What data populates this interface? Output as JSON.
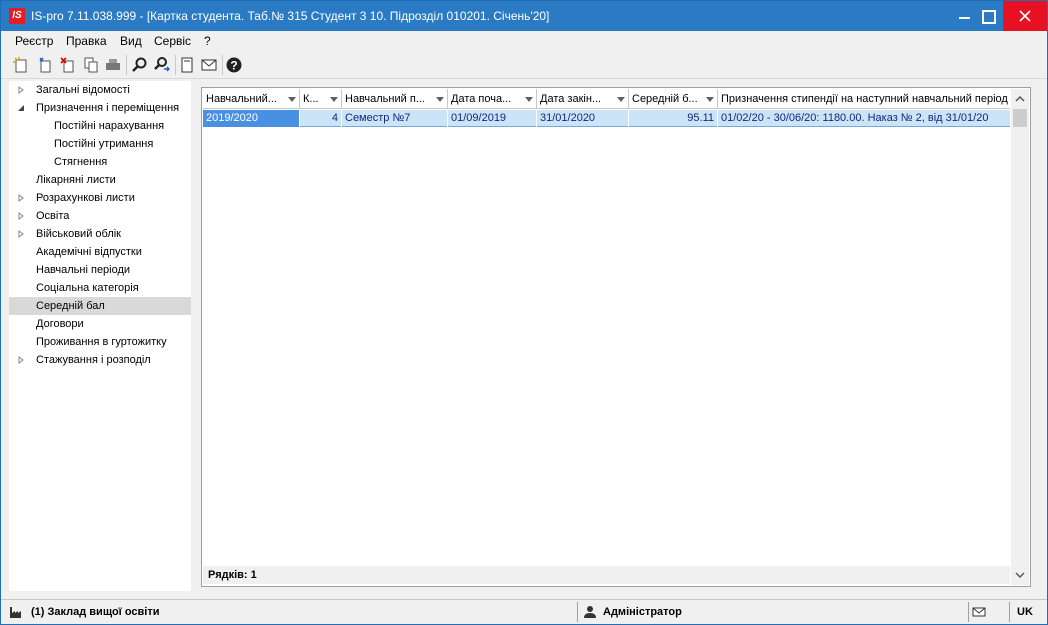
{
  "window": {
    "logo_text": "IS",
    "title": "IS-pro 7.11.038.999 - [Картка студента. Таб.№ 315 Студент 3 10. Підрозділ 010201. Січень'20]"
  },
  "menu": [
    "Реєстр",
    "Правка",
    "Вид",
    "Сервіс",
    "?"
  ],
  "toolbar": {
    "icons": [
      "new-icon",
      "copy-new-icon",
      "delete-icon",
      "duplicate-icon",
      "print-icon",
      "find-icon",
      "find-next-icon",
      "form-icon",
      "mail-icon",
      "help-icon"
    ]
  },
  "tree": {
    "items": [
      {
        "label": "Загальні відомості",
        "expand": "collapsed",
        "level": 0
      },
      {
        "label": "Призначення і переміщення",
        "expand": "expanded",
        "level": 0
      },
      {
        "label": "Постійні нарахування",
        "expand": "none",
        "level": 1
      },
      {
        "label": "Постійні утримання",
        "expand": "none",
        "level": 1
      },
      {
        "label": "Стягнення",
        "expand": "none",
        "level": 1
      },
      {
        "label": "Лікарняні листи",
        "expand": "none",
        "level": 0
      },
      {
        "label": "Розрахункові листи",
        "expand": "collapsed",
        "level": 0
      },
      {
        "label": "Освіта",
        "expand": "collapsed",
        "level": 0
      },
      {
        "label": "Військовий облік",
        "expand": "collapsed",
        "level": 0
      },
      {
        "label": "Академічні відпустки",
        "expand": "none",
        "level": 0
      },
      {
        "label": "Навчальні періоди",
        "expand": "none",
        "level": 0
      },
      {
        "label": "Соціальна категорія",
        "expand": "none",
        "level": 0
      },
      {
        "label": "Середній бал",
        "expand": "none",
        "level": 0,
        "selected": true
      },
      {
        "label": "Договори",
        "expand": "none",
        "level": 0
      },
      {
        "label": "Проживання в гуртожитку",
        "expand": "none",
        "level": 0
      },
      {
        "label": "Стажування і розподіл",
        "expand": "collapsed",
        "level": 0
      }
    ]
  },
  "grid": {
    "columns": [
      "Навчальний...",
      "К...",
      "Навчальний п...",
      "Дата поча...",
      "Дата закін...",
      "Середній б...",
      "Призначення стипендії на наступний навчальний період"
    ],
    "rows": [
      [
        "2019/2020",
        "4",
        "Семестр №7",
        "01/09/2019",
        "31/01/2020",
        "95.11",
        "01/02/20 - 30/06/20: 1180.00. Наказ № 2, від 31/01/20"
      ]
    ],
    "footer": "Рядків: 1"
  },
  "statusbar": {
    "org": "(1) Заклад вищої освіти",
    "user": "Адміністратор",
    "lang": "UK"
  },
  "colors": {
    "titlebar": "#2b7bc4",
    "close": "#e81123",
    "row_selected": "#cce4f7",
    "cell_focus": "#4a90e2"
  }
}
